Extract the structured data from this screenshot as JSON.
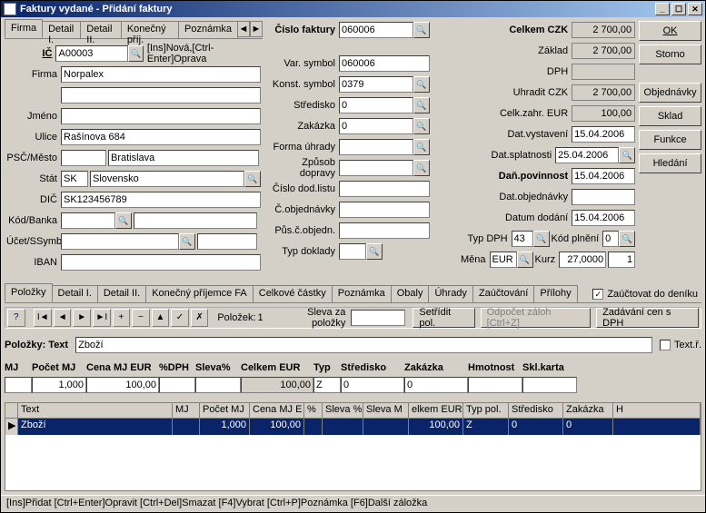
{
  "window": {
    "title": "Faktury vydané - Přidání faktury"
  },
  "tabs_main": {
    "t1": "Firma",
    "t2": "Detail I.",
    "t3": "Detail II.",
    "t4": "Konečný příj.",
    "t5": "Poznámka"
  },
  "buttons": {
    "ok": "OK",
    "storno": "Storno",
    "objednavky": "Objednávky",
    "sklad": "Sklad",
    "funkce": "Funkce",
    "hledani": "Hledání",
    "setridit": "Setřídit pol.",
    "odpocet": "Odpočet záloh [Ctrl+Z]",
    "zadavani": "Zadávání cen s DPH"
  },
  "firma": {
    "ic_label": "IČ",
    "ic": "A00003",
    "hint": "[Ins]Nová,[Ctrl-Enter]Oprava",
    "firma_label": "Firma",
    "firma": "Norpalex",
    "jmeno_label": "Jméno",
    "jmeno": "",
    "ulice_label": "Ulice",
    "ulice": "Rašínova 684",
    "psc_label": "PSČ/Město",
    "psc": "",
    "mesto": "Bratislava",
    "stat_label": "Stát",
    "stat_kod": "SK",
    "stat": "Slovensko",
    "dic_label": "DIČ",
    "dic": "SK123456789",
    "kod_banka_label": "Kód/Banka",
    "kod_banka": "",
    "banka": "",
    "ucet_label": "Účet/SSymb",
    "ucet": "",
    "ssymb": "",
    "iban_label": "IBAN",
    "iban": ""
  },
  "faktura": {
    "cislo_label": "Číslo faktury",
    "cislo": "060006",
    "var_label": "Var. symbol",
    "var": "060006",
    "konst_label": "Konst. symbol",
    "konst": "0379",
    "stredisko_label": "Středisko",
    "stredisko": "0",
    "zakazka_label": "Zakázka",
    "zakazka": "0",
    "forma_label": "Forma úhrady",
    "forma": "",
    "zpusob_label": "Způsob dopravy",
    "zpusob": "",
    "dodlist_label": "Číslo dod.listu",
    "dodlist": "",
    "cobj_label": "Č.objednávky",
    "cobj": "",
    "puv_label": "Půs.č.objedn.",
    "puv": "",
    "typdokl_label": "Typ doklady",
    "typdokl": ""
  },
  "totals": {
    "celkem_label": "Celkem CZK",
    "celkem": "2 700,00",
    "zaklad_label": "Základ",
    "zaklad": "2 700,00",
    "dph_label": "DPH",
    "dph": "",
    "uhradit_label": "Uhradit CZK",
    "uhradit": "2 700,00",
    "zahr_label": "Celk.zahr. EUR",
    "zahr": "100,00",
    "vystaveni_label": "Dat.vystavení",
    "vystaveni": "15.04.2006",
    "splatnosti_label": "Dat.splatnosti",
    "splatnosti": "25.04.2006",
    "povinnost_label": "Daň.povinnost",
    "povinnost": "15.04.2006",
    "datobj_label": "Dat.objednávky",
    "datobj": "",
    "dodani_label": "Datum dodání",
    "dodani": "15.04.2006",
    "typdph_label": "Typ DPH",
    "typdph": "43",
    "kodpln_label": "Kód plnění",
    "kodpln": "0",
    "mena_label": "Měna",
    "mena": "EUR",
    "kurz_label": "Kurz",
    "kurz": "27,0000",
    "kurz2": "1"
  },
  "tabs_lower": {
    "t1": "Položky",
    "t2": "Detail I.",
    "t3": "Detail II.",
    "t4": "Konečný příjemce FA",
    "t5": "Celkové částky",
    "t6": "Poznámka",
    "t7": "Obaly",
    "t8": "Úhrady",
    "t9": "Zaúčtování",
    "t10": "Přílohy"
  },
  "zauctovat_label": "Zaúčtovat do deníku",
  "polozek_label": "Položek:",
  "polozek": "1",
  "sleva_label": "Sleva za položky",
  "polozky_text_label": "Položky: Text",
  "polozky_text": "Zboží",
  "textr_label": "Text.ř.",
  "cols": {
    "mj": "MJ",
    "pocet": "Počet MJ",
    "cena": "Cena MJ EUR",
    "pdph": "%DPH",
    "slevap": "Sleva%",
    "celkem": "Celkem EUR",
    "typ": "Typ",
    "stredisko": "Středisko",
    "zakazka": "Zakázka",
    "hmotnost": "Hmotnost",
    "sklkarta": "Skl.karta"
  },
  "edit": {
    "mj": "",
    "pocet": "1,000",
    "cena": "100,00",
    "pdph": "",
    "slevap": "",
    "celkem": "100,00",
    "typ": "Z",
    "stredisko": "0",
    "zakazka": "0",
    "hmotnost": "",
    "sklkarta": ""
  },
  "gcols": {
    "text": "Text",
    "mj": "MJ",
    "pocet": "Počet MJ",
    "cena": "Cena MJ E",
    "pct": "%",
    "slevas": "Sleva %",
    "slevam": "Sleva M",
    "celkem": "elkem EUR",
    "typpol": "Typ pol.",
    "stredisko": "Středisko",
    "zakazka": "Zakázka",
    "h": "H"
  },
  "grow": {
    "text": "Zboží",
    "mj": "",
    "pocet": "1,000",
    "cena": "100,00",
    "pct": "",
    "slevas": "",
    "slevam": "",
    "celkem": "100,00",
    "typpol": "Z",
    "stredisko": "0",
    "zakazka": "0",
    "h": ""
  },
  "status": "[Ins]Přidat [Ctrl+Enter]Opravit [Ctrl+Del]Smazat [F4]Vybrat [Ctrl+P]Poznámka [F6]Další záložka"
}
